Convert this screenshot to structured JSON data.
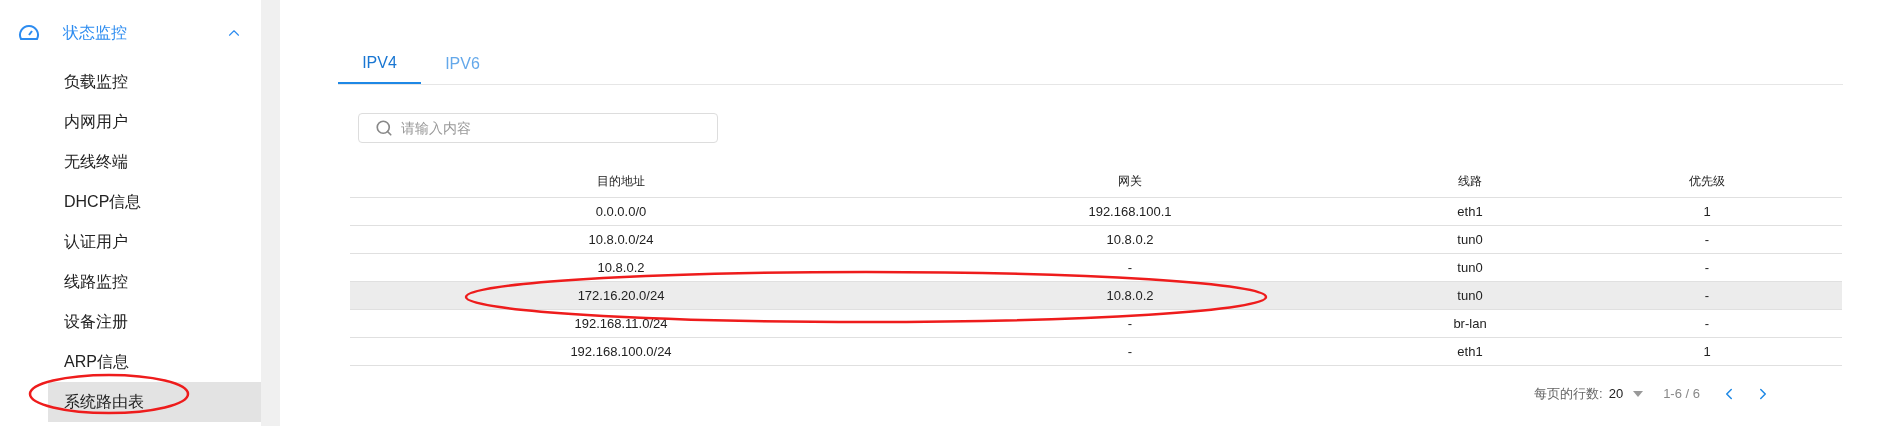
{
  "sidebar": {
    "group": {
      "label": "状态监控",
      "expanded": true
    },
    "items": [
      {
        "label": "负载监控",
        "selected": false
      },
      {
        "label": "内网用户",
        "selected": false
      },
      {
        "label": "无线终端",
        "selected": false
      },
      {
        "label": "DHCP信息",
        "selected": false
      },
      {
        "label": "认证用户",
        "selected": false
      },
      {
        "label": "线路监控",
        "selected": false
      },
      {
        "label": "设备注册",
        "selected": false
      },
      {
        "label": "ARP信息",
        "selected": false
      },
      {
        "label": "系统路由表",
        "selected": true
      }
    ]
  },
  "tabs": [
    {
      "label": "IPV4",
      "selected": true
    },
    {
      "label": "IPV6",
      "selected": false
    }
  ],
  "search": {
    "placeholder": "请输入内容"
  },
  "table": {
    "columns": [
      "目的地址",
      "网关",
      "线路",
      "优先级"
    ],
    "rows": [
      {
        "cells": [
          "0.0.0.0/0",
          "192.168.100.1",
          "eth1",
          "1"
        ],
        "selected": false
      },
      {
        "cells": [
          "10.8.0.0/24",
          "10.8.0.2",
          "tun0",
          "-"
        ],
        "selected": false
      },
      {
        "cells": [
          "10.8.0.2",
          "-",
          "tun0",
          "-"
        ],
        "selected": false
      },
      {
        "cells": [
          "172.16.20.0/24",
          "10.8.0.2",
          "tun0",
          "-"
        ],
        "selected": true
      },
      {
        "cells": [
          "192.168.11.0/24",
          "-",
          "br-lan",
          "-"
        ],
        "selected": false
      },
      {
        "cells": [
          "192.168.100.0/24",
          "-",
          "eth1",
          "1"
        ],
        "selected": false
      }
    ]
  },
  "pagination": {
    "rows_per_page_label": "每页的行数:",
    "rows_per_page": "20",
    "range": "1-6 / 6"
  }
}
